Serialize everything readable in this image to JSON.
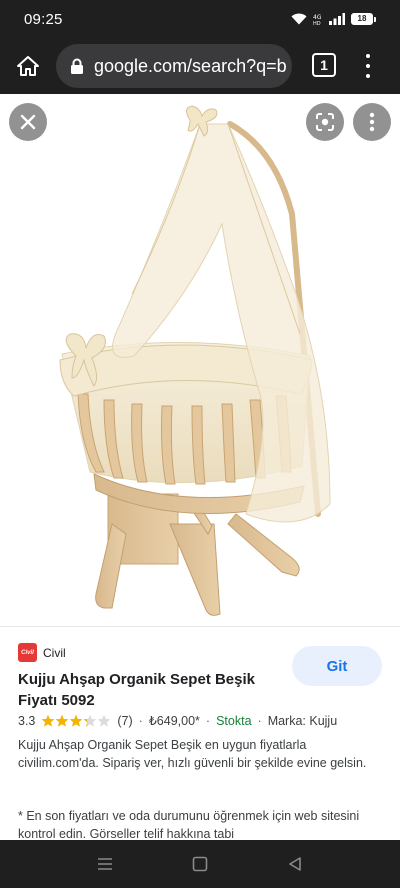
{
  "status_bar": {
    "time": "09:25",
    "battery": "18"
  },
  "browser": {
    "url": "google.com/search?q=b",
    "tab_count": "1"
  },
  "image_viewer": {
    "close_icon": "close-icon",
    "lens_icon": "google-lens-icon",
    "more_icon": "more-vert-icon"
  },
  "result": {
    "source_name": "Civil",
    "favicon_text": "Civil",
    "visit_label": "Git",
    "title": "Kujju Ahşap Organik Sepet Beşik Fiyatı 5092",
    "rating": "3.3",
    "rating_value": 3.3,
    "rating_max": 5,
    "review_count": "(7)",
    "price": "₺649,00*",
    "stock": "Stokta",
    "brand": "Marka: Kujju",
    "description": "Kujju Ahşap Organik Sepet Beşik en uygun fiyatlarla civilim.com'da. Sipariş ver, hızlı güvenli bir şekilde evine gelsin.",
    "note": "* En son fiyatları ve oda durumunu öğrenmek için web sitesini kontrol edin. Görseller telif hakkına tabi"
  },
  "colors": {
    "accent": "#1a73e8",
    "star": "#f4b400",
    "stock": "#188038",
    "brand_red": "#e53935"
  }
}
